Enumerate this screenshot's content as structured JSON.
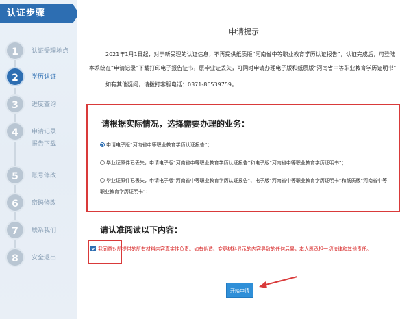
{
  "sidebar": {
    "title": "认证步骤",
    "steps": [
      {
        "num": "1",
        "label": "认证受理地点"
      },
      {
        "num": "2",
        "label": "学历认证"
      },
      {
        "num": "3",
        "label": "进度查询"
      },
      {
        "num": "4",
        "label": "申请记录",
        "sub": "报告下载"
      },
      {
        "num": "5",
        "label": "账号修改"
      },
      {
        "num": "6",
        "label": "密码修改"
      },
      {
        "num": "7",
        "label": "联系我们"
      },
      {
        "num": "8",
        "label": "安全退出"
      }
    ]
  },
  "main": {
    "title": "申请提示",
    "notice": "2021年1月1日起，对于新受理的认证信息，不再提供纸质版“河南省中等职业教育学历认证报告”，认证完成后，可登陆本系统在“申请记录”下载打印电子报告证书，原毕业证丢失，可同时申请办理电子版和纸质版“河南省中等职业教育学历证明书”",
    "contact": "如有其他疑问，请拨打客服电话：0371-86539759。",
    "business_heading": "请根据实际情况，选择需要办理的业务：",
    "options": [
      "申请电子版“河南省中等职业教育学历认证报告”；",
      "毕业证原件已丢失，申请电子版“河南省中等职业教育学历认证报告”和电子版“河南省中等职业教育学历证明书”；",
      "毕业证原件已丢失，申请电子版“河南省中等职业教育学历认证报告”、电子版“河南省中等职业教育学历证明书”和纸质版“河南省中等职业教育学历证明书”；"
    ],
    "read_heading": "请认准阅读以下内容：",
    "agreement": "我同意对所提供的所有材料内容真实性负责。如有伪造、变更材料显示的内容导致的任何后果，本人愿承担一切法律和其他责任。",
    "start_button": "开始申请"
  },
  "colors": {
    "accent": "#2d6eb2",
    "highlight_red": "#d93a3a",
    "button_blue": "#2f8fd8"
  }
}
